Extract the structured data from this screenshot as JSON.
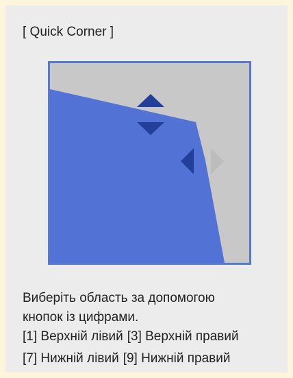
{
  "title": "[ Quick Corner ]",
  "preview": {
    "colors": {
      "background": "#c8c8c8",
      "area": "#5272d6",
      "frame": "#5878cc",
      "arrow_active": "#233f99",
      "arrow_inactive": "#bcbcbc"
    },
    "arrows": {
      "up": "active",
      "down": "active",
      "left": "active",
      "right": "inactive"
    }
  },
  "instructions": {
    "line1": "Виберіть область за допомогою",
    "line2": "кнопок із цифрами.",
    "upper_left": "[1] Верхній лівий",
    "upper_right": "[3] Верхній правий",
    "lower_left": "[7] Нижній лівий",
    "lower_right": "[9] Нижній правий"
  }
}
